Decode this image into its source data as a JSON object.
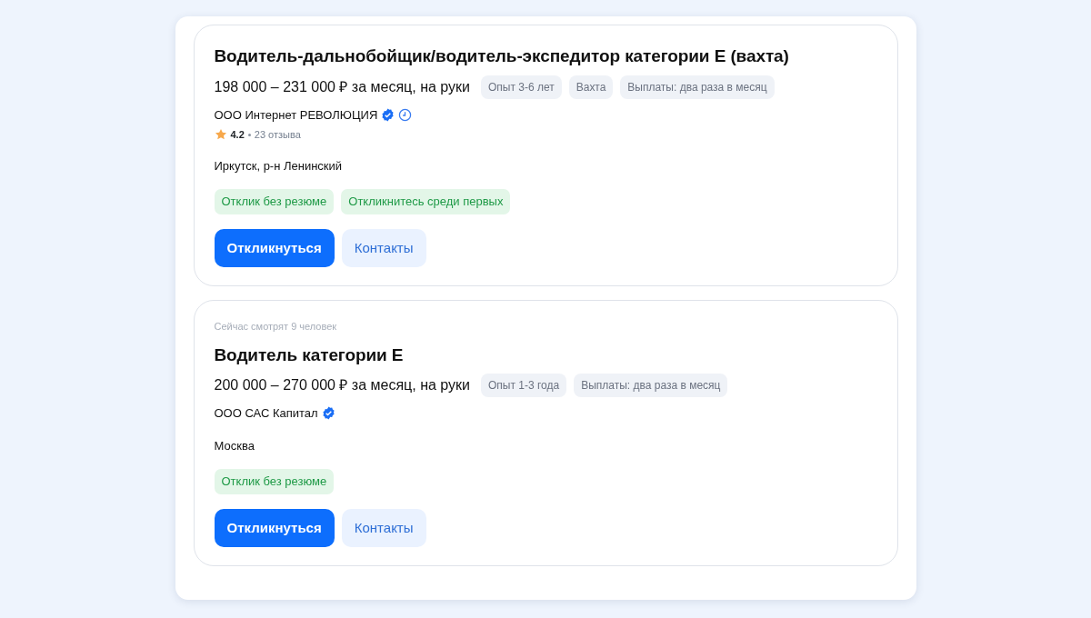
{
  "vacancies": [
    {
      "title": "Водитель-дальнобойщик/водитель-экспедитор категории Е (вахта)",
      "salary": "198 000 – 231 000 ₽ за месяц, на руки",
      "chips": [
        "Опыт 3-6 лет",
        "Вахта",
        "Выплаты: два раза в месяц"
      ],
      "company": {
        "name": "ООО Интернет РЕВОЛЮЦИЯ",
        "verified": true,
        "trusted": true
      },
      "rating": {
        "score": "4.2",
        "reviews": "23 отзыва"
      },
      "city": "Иркутск, р-н Ленинский",
      "tags": [
        "Отклик без резюме",
        "Откликнитесь среди первых"
      ],
      "buttons": [
        {
          "label": "Откликнуться",
          "kind": "primary"
        },
        {
          "label": "Контакты",
          "kind": "secondary"
        }
      ]
    },
    {
      "watching": "Сейчас смотрят 9 человек",
      "title": "Водитель категории Е",
      "salary": "200 000 – 270 000 ₽ за месяц, на руки",
      "chips": [
        "Опыт 1-3 года",
        "Выплаты: два раза в месяц"
      ],
      "company": {
        "name": "ООО САС Капитал",
        "verified": true,
        "trusted": false
      },
      "city": "Москва",
      "tags": [
        "Отклик без резюме"
      ],
      "buttons": [
        {
          "label": "Откликнуться",
          "kind": "primary"
        },
        {
          "label": "Контакты",
          "kind": "secondary"
        }
      ]
    }
  ]
}
